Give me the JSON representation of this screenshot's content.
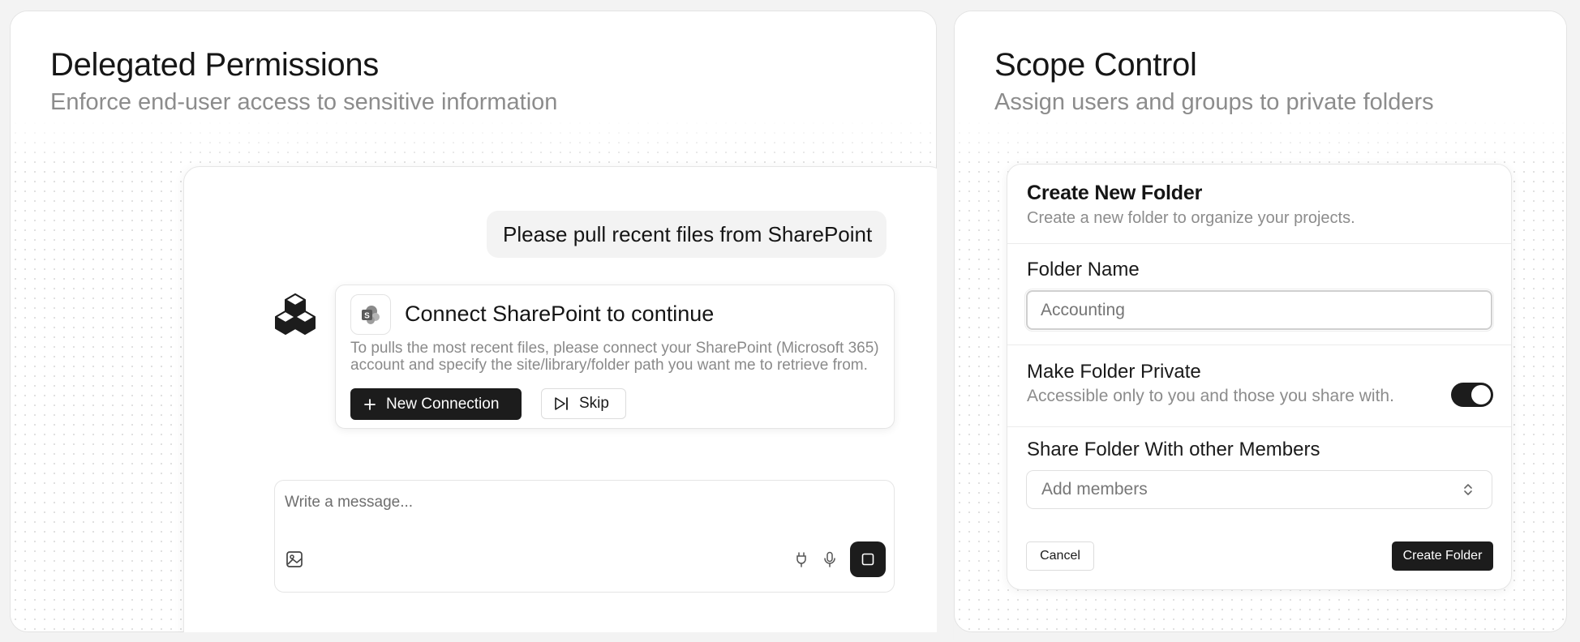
{
  "left_panel": {
    "title": "Delegated Permissions",
    "subtitle": "Enforce end-user access to sensitive information",
    "chat": {
      "user_message": "Please pull recent files from SharePoint",
      "assistant": {
        "title": "Connect SharePoint to continue",
        "body": "To pulls the most recent files, please connect your SharePoint (Microsoft 365) account and specify the site/library/folder path you want me to retrieve from.",
        "new_connection_label": "New Connection",
        "skip_label": "Skip"
      },
      "composer": {
        "placeholder": "Write a message..."
      }
    }
  },
  "right_panel": {
    "title": "Scope Control",
    "subtitle": "Assign users and groups to private folders",
    "form": {
      "title": "Create New Folder",
      "subtitle": "Create a new folder to organize your projects.",
      "folder_name_label": "Folder Name",
      "folder_name_placeholder": "Accounting",
      "private_label": "Make Folder Private",
      "private_description": "Accessible only to you and those you share with.",
      "private_enabled": true,
      "share_label": "Share Folder With other Members",
      "members_placeholder": "Add members",
      "cancel_label": "Cancel",
      "create_label": "Create Folder"
    }
  },
  "colors": {
    "accent_dark": "#1c1c1c",
    "muted_text": "#8c8c8c",
    "background": "#f3f3f3"
  },
  "icons": [
    "hexagon-cubes-logo-icon",
    "sharepoint-icon",
    "plus-icon",
    "skip-forward-icon",
    "image-icon",
    "plug-icon",
    "microphone-icon",
    "stop-square-icon",
    "chevron-up-down-icon"
  ]
}
